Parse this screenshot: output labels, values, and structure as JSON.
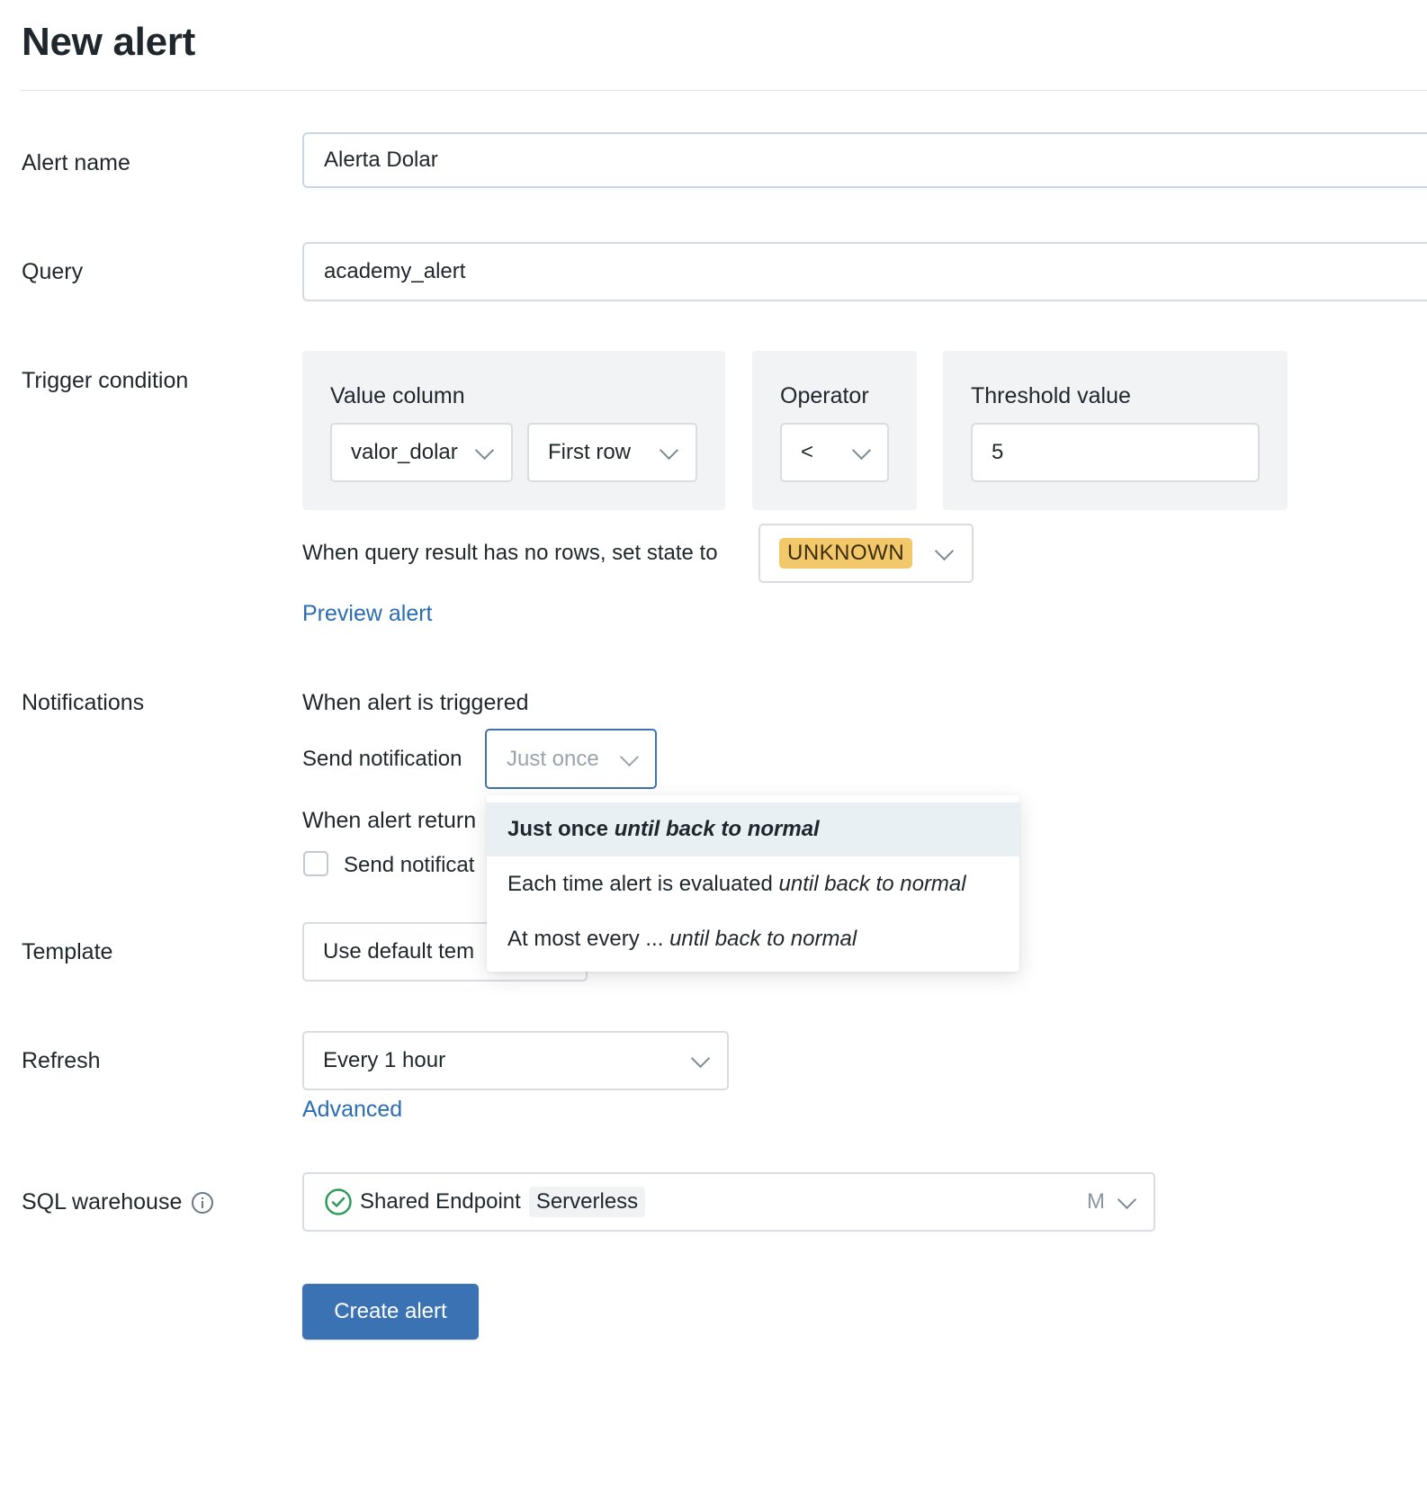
{
  "page": {
    "title": "New alert"
  },
  "labels": {
    "alert_name": "Alert name",
    "query": "Query",
    "trigger_condition": "Trigger condition",
    "notifications": "Notifications",
    "template": "Template",
    "refresh": "Refresh",
    "sql_warehouse": "SQL warehouse"
  },
  "alert_name": {
    "value": "Alerta Dolar"
  },
  "query": {
    "value": "academy_alert"
  },
  "trigger": {
    "value_column_title": "Value column",
    "value_column": "valor_dolar",
    "row_selector": "First row",
    "operator_title": "Operator",
    "operator": "<",
    "threshold_title": "Threshold value",
    "threshold": "5",
    "no_rows_text": "When query result has no rows, set state to",
    "no_rows_state": "UNKNOWN",
    "no_rows_state_color": "#f2c86a",
    "preview_link": "Preview alert"
  },
  "notifications": {
    "triggered_heading": "When alert is triggered",
    "send_notification_label": "Send notification",
    "send_notification_value": "Just once",
    "returns_heading_visible": "When alert return",
    "returns_checkbox_label_visible": "Send notificat",
    "returns_checkbox_checked": false,
    "dropdown_options": [
      {
        "prefix": "Just once",
        "suffix": "until back to normal",
        "selected": true
      },
      {
        "prefix": "Each time alert is evaluated",
        "suffix": "until back to normal",
        "selected": false
      },
      {
        "prefix": "At most every ...",
        "suffix": "until back to normal",
        "selected": false
      }
    ]
  },
  "template": {
    "value_visible": "Use default tem"
  },
  "refresh": {
    "value": "Every 1 hour",
    "advanced_link": "Advanced"
  },
  "warehouse": {
    "name": "Shared Endpoint",
    "tag": "Serverless",
    "size": "M",
    "status_icon": "check-circle-icon",
    "status_color": "#2e9b5b"
  },
  "actions": {
    "create_label": "Create alert"
  },
  "colors": {
    "accent": "#3a72b4",
    "link": "#2a6db2",
    "focus_border": "#3f72b0"
  }
}
